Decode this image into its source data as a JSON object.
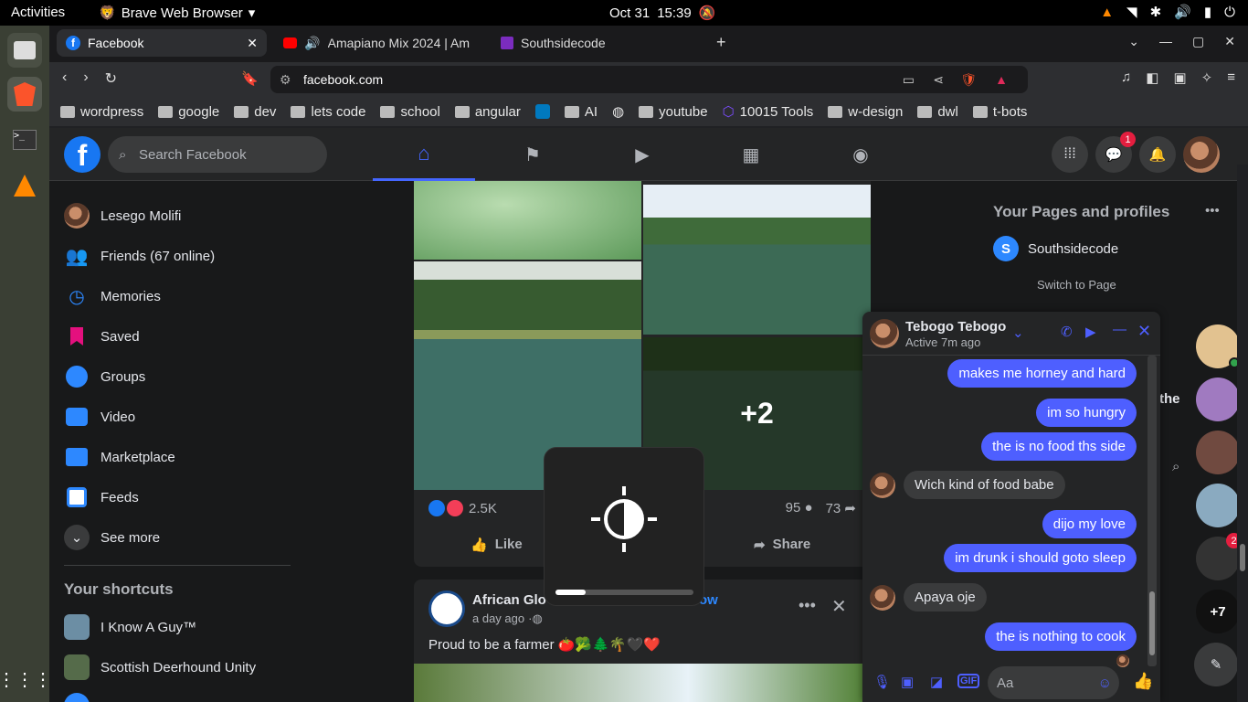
{
  "system": {
    "activities": "Activities",
    "app_name": "Brave Web Browser",
    "date": "Oct 31",
    "time": "15:39"
  },
  "tabs": [
    {
      "title": "Facebook",
      "active": true
    },
    {
      "title": "Amapiano Mix 2024 | Am",
      "active": false
    },
    {
      "title": "Southsidecode",
      "active": false
    }
  ],
  "address": {
    "url": "facebook.com"
  },
  "bookmarks": [
    "wordpress",
    "google",
    "dev",
    "lets code",
    "school",
    "angular",
    "",
    "AI",
    "",
    "youtube",
    "10015 Tools",
    "w-design",
    "dwl",
    "t-bots"
  ],
  "facebook": {
    "search_placeholder": "Search Facebook",
    "messenger_badge": "1",
    "left_nav": [
      "Lesego Molifi",
      "Friends (67 online)",
      "Memories",
      "Saved",
      "Groups",
      "Video",
      "Marketplace",
      "Feeds",
      "See more"
    ],
    "shortcuts_title": "Your shortcuts",
    "shortcuts": [
      "I Know A Guy™",
      "Scottish Deerhound Unity"
    ],
    "post1": {
      "more_count": "+2",
      "reactions": "2.5K",
      "comments": "95",
      "shares": "73",
      "like": "Like",
      "share": "Share"
    },
    "post2": {
      "author": "African Glo",
      "follow": "ow",
      "time": "a day ago",
      "text": "Proud to be a farmer 🍅🥦🌲🌴🖤❤️"
    },
    "right": {
      "title": "Your Pages and profiles",
      "page": "Southsidecode",
      "switch": "Switch to Page",
      "partial": "the",
      "contact_badge": "2",
      "more_contacts": "+7"
    }
  },
  "chat": {
    "name": "Tebogo Tebogo",
    "status": "Active 7m ago",
    "messages": [
      {
        "from": "me",
        "text": "makes me horney and hard"
      },
      {
        "from": "me",
        "text": "im so hungry"
      },
      {
        "from": "me",
        "text": "the is no food ths side"
      },
      {
        "from": "them",
        "text": "Wich kind of food babe"
      },
      {
        "from": "me",
        "text": "dijo my love"
      },
      {
        "from": "me",
        "text": "im drunk i should goto sleep"
      },
      {
        "from": "them",
        "text": "Apaya oje"
      },
      {
        "from": "me",
        "text": "the is nothing to cook"
      }
    ],
    "input_placeholder": "Aa"
  },
  "osd": {
    "brightness": 0.22
  },
  "colors": {
    "accent": "#4e5fff",
    "fb_blue": "#1877f2",
    "badge": "#e41e3f"
  }
}
